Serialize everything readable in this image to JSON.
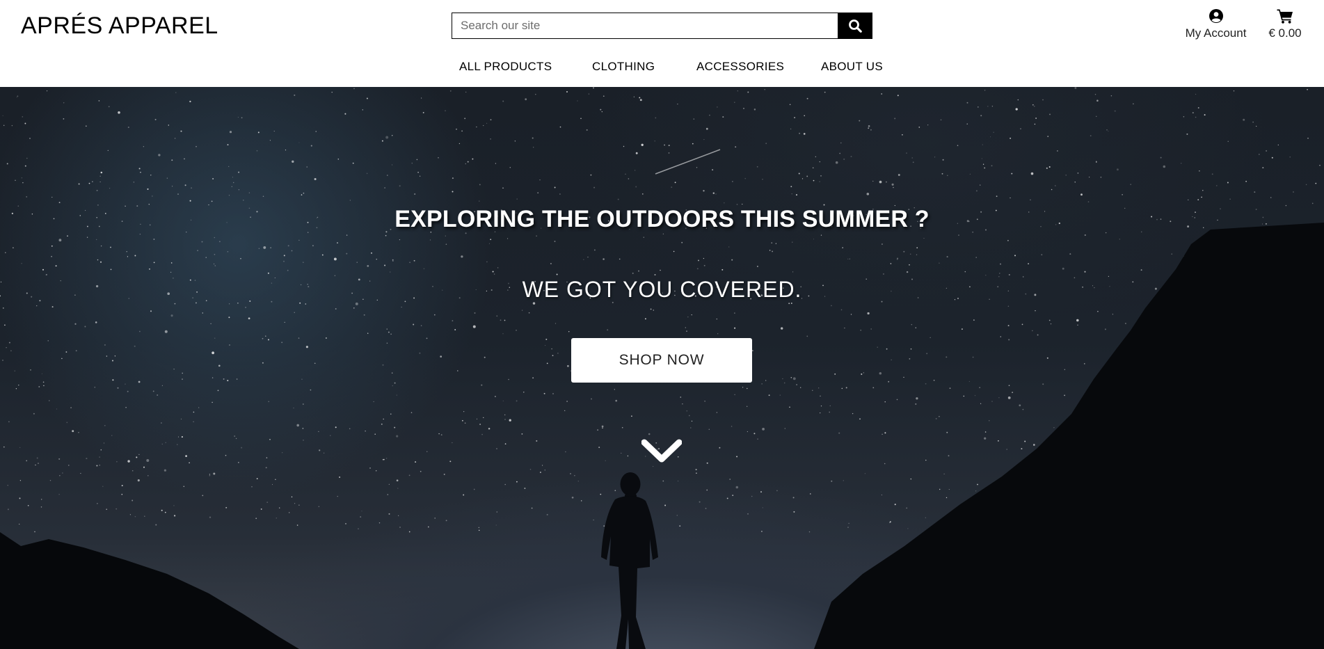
{
  "header": {
    "logo": "APRÉS APPAREL",
    "search": {
      "placeholder": "Search our site",
      "value": "",
      "icon": "search-icon"
    },
    "account": {
      "label": "My Account",
      "icon": "user-circle-icon"
    },
    "cart": {
      "total": "€ 0.00",
      "icon": "shopping-cart-icon"
    }
  },
  "nav": {
    "items": [
      {
        "label": "ALL PRODUCTS"
      },
      {
        "label": "CLOTHING"
      },
      {
        "label": "ACCESSORIES"
      },
      {
        "label": "ABOUT US"
      }
    ]
  },
  "hero": {
    "headline": "EXPLORING THE OUTDOORS THIS SUMMER ?",
    "subline": "WE GOT YOU COVERED.",
    "cta_label": "SHOP NOW",
    "scroll_icon": "chevron-down-icon"
  },
  "colors": {
    "header_bg": "#ffffff",
    "text": "#000000",
    "search_button_bg": "#000000",
    "hero_sky": "#1c232c",
    "cta_bg": "#ffffff"
  }
}
